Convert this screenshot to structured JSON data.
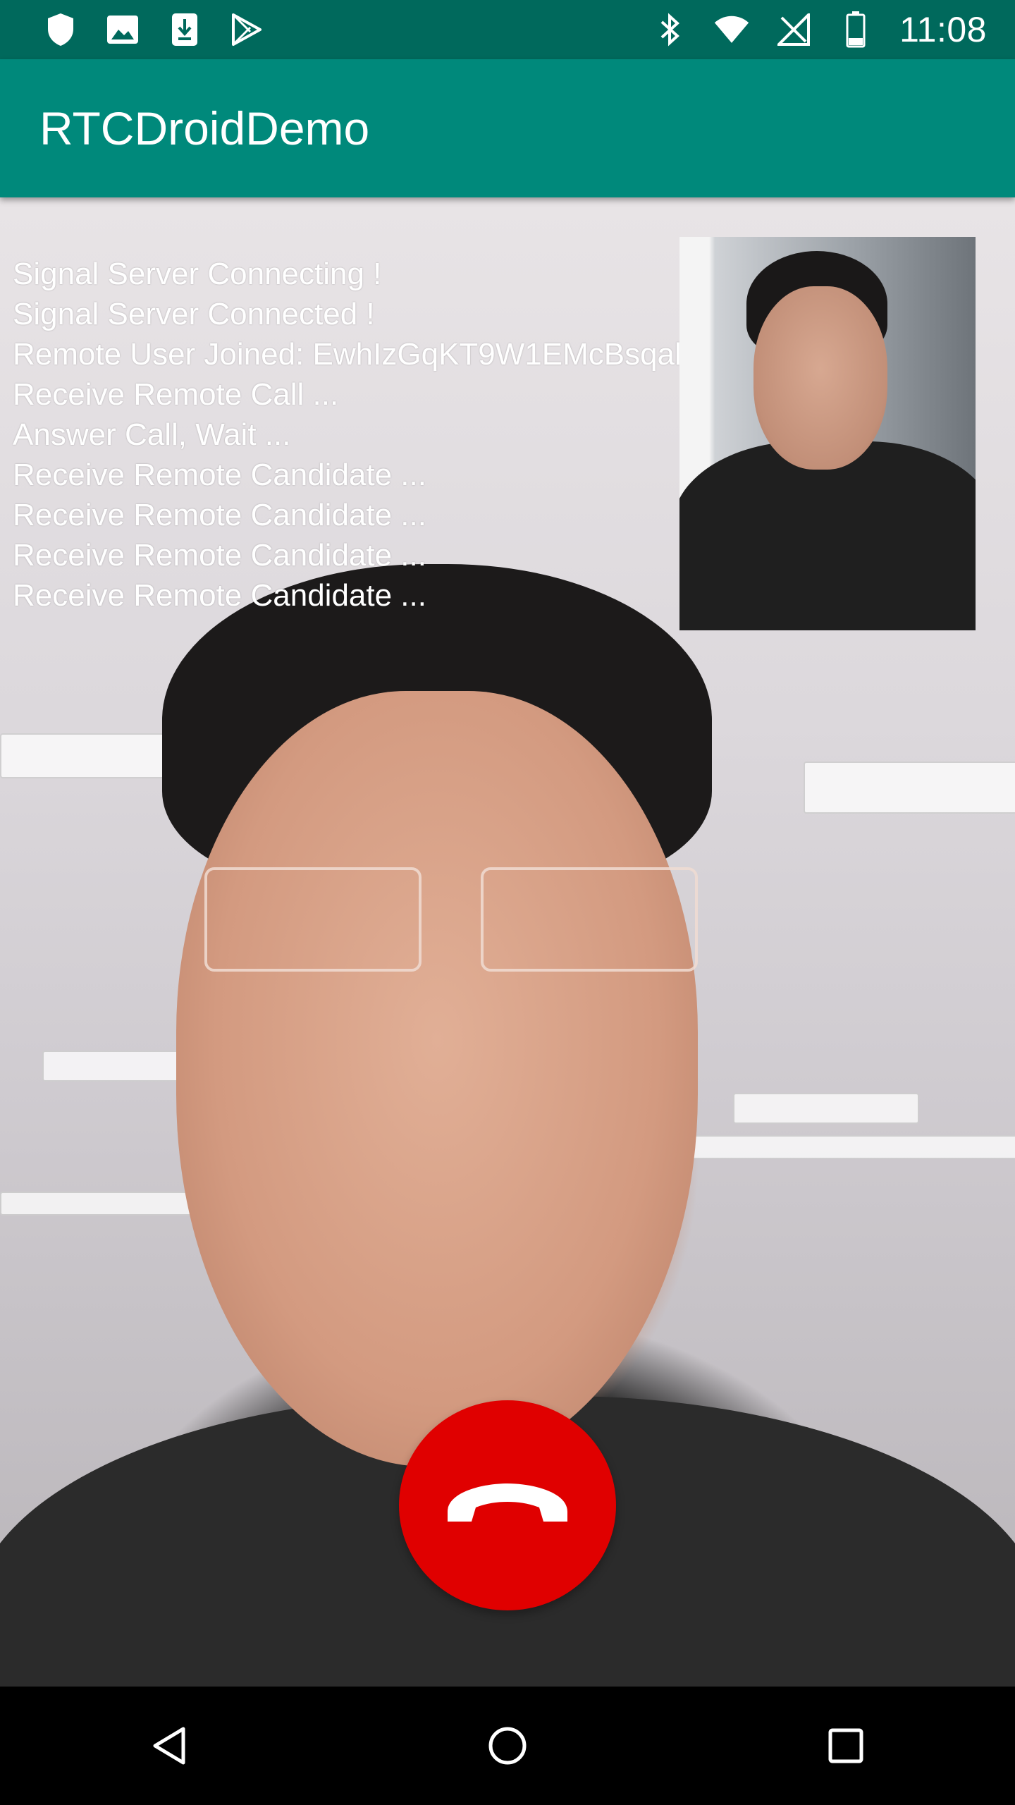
{
  "status_bar": {
    "time": "11:08",
    "left_icons": [
      "shield-icon",
      "image-icon",
      "download-icon",
      "play-store-icon"
    ],
    "right_icons": [
      "bluetooth-icon",
      "wifi-icon",
      "signal-off-icon",
      "battery-icon"
    ]
  },
  "app_bar": {
    "title": "RTCDroidDemo"
  },
  "log": {
    "lines": [
      "Signal Server Connecting !",
      "Signal Server Connected !",
      "Remote User Joined: EwhIzGqKT9W1EMcBsqal",
      "Receive Remote Call ...",
      "Answer Call, Wait ...",
      "Receive Remote Candidate ...",
      "Receive Remote Candidate ...",
      "Receive Remote Candidate ...",
      "Receive Remote Candidate ..."
    ]
  },
  "call": {
    "hangup_color": "#e00000"
  },
  "nav_bar": {
    "buttons": [
      "back-icon",
      "home-icon",
      "recents-icon"
    ]
  },
  "colors": {
    "status_bar": "#00695c",
    "app_bar": "#00897b"
  }
}
